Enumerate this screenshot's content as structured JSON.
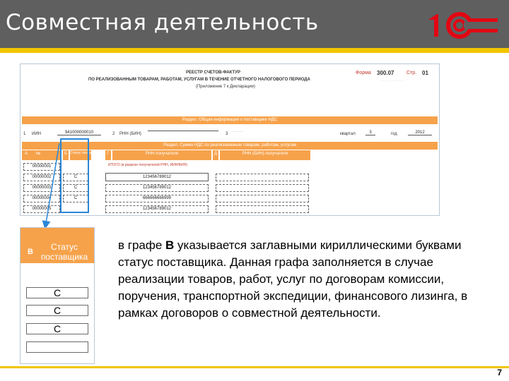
{
  "header": {
    "title": "Совместная деятельность",
    "logo_text": "1С",
    "accent": "#f2c500",
    "brand_red": "#e30613"
  },
  "form": {
    "title_line1": "РЕЕСТР СЧЕТОВ-ФАКТУР",
    "title_line2": "ПО РЕАЛИЗОВАННЫМ ТОВАРАМ, РАБОТАМ, УСЛУГАМ В ТЕЧЕНИЕ ОТЧЕТНОГО НАЛОГОВОГО ПЕРИОДА",
    "title_line3": "(Приложение 7 к Декларации)",
    "form_label": "Форма",
    "form_number": "300.07",
    "page_label": "Стр.",
    "page_value": "01",
    "section_title": "Раздел. Общая информация о поставщике НДС",
    "row1_num1": "1",
    "row1_inn_label": "ИИН",
    "row1_inn_value": "941000000010",
    "row1_num2": "2",
    "row1_reg_label": "РНН (БИН)",
    "row1_num3": "3",
    "row1_period_label": "квартал",
    "row1_quarter": "3",
    "row1_year_label": "год",
    "row1_year": "2012",
    "section2_title": "Раздел. Сумма НДС по реализованным товарам, работам, услугам",
    "col_a_letter": "А",
    "col_a_label": "№",
    "col_b_letter": "Б",
    "col_v_letter": "В",
    "col_v_label": "Статус поставщика",
    "col_g_letter": "Г",
    "col_g_label": "РНН получателя",
    "col_d_letter": "Д",
    "col_d_label": "РНН (БИН) получателя",
    "note_text": "ИТОГО (в разрезе получателей РНН, ИИН/БИН)",
    "rows": [
      {
        "num": "00000001",
        "status": "",
        "rnn": ""
      },
      {
        "num": "00000002",
        "status": "С",
        "rnn": "123456789012"
      },
      {
        "num": "00000003",
        "status": "С",
        "rnn": "123456789012"
      },
      {
        "num": "00000004",
        "status": "С",
        "rnn": "666666666999"
      },
      {
        "num": "00000005",
        "status": "",
        "rnn": "123456789012"
      }
    ]
  },
  "zoom": {
    "letter": "В",
    "title": "Статус поставщика",
    "cells": [
      "С",
      "С",
      "С",
      ""
    ]
  },
  "description": {
    "prefix": "в графе ",
    "bold": "В",
    "rest": " указывается заглавными кириллическими буквами статус поставщика. Данная графа заполняется в случае реализации товаров, работ, услуг по договорам комиссии, поручения, транспортной экспедиции, финансового лизинга, в рамках договоров о совместной деятельности."
  },
  "page_number": "7"
}
